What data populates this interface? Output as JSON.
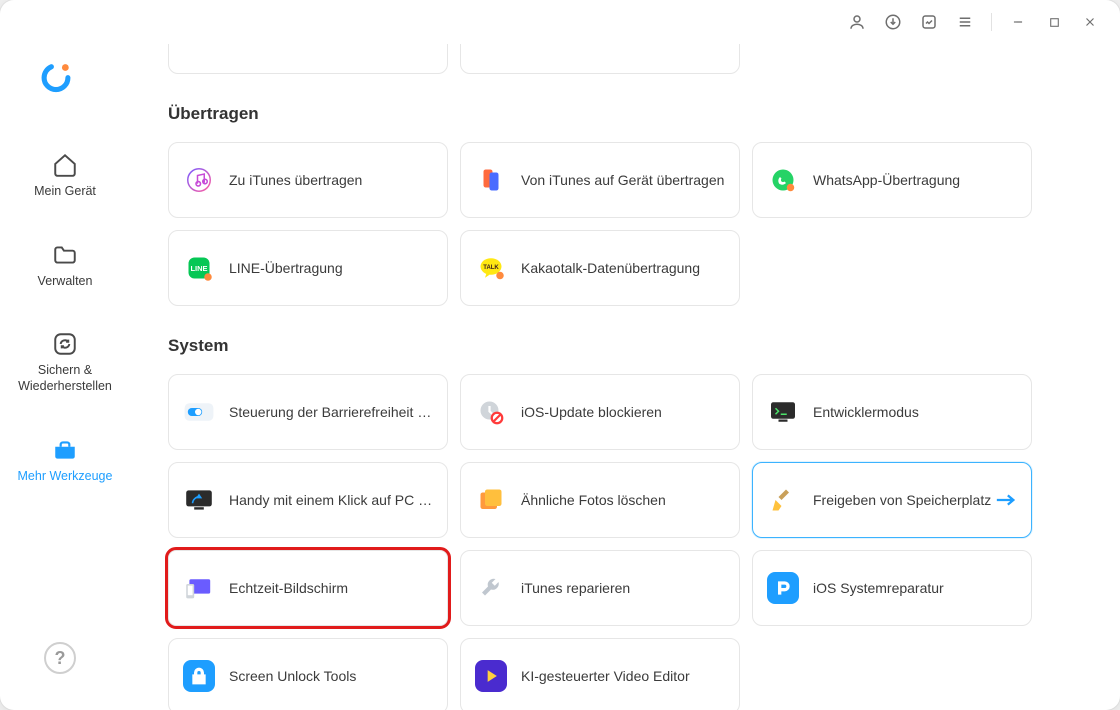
{
  "sidebar": {
    "logo_alt": "App logo",
    "items": [
      {
        "label": "Mein Gerät"
      },
      {
        "label": "Verwalten"
      },
      {
        "label": "Sichern & Wiederherstellen"
      },
      {
        "label": "Mehr Werkzeuge"
      }
    ],
    "help_label": "?"
  },
  "sections": {
    "ubertragen": {
      "title": "Übertragen",
      "cards": [
        {
          "label": "Zu iTunes übertragen"
        },
        {
          "label": "Von iTunes auf Gerät übertragen"
        },
        {
          "label": "WhatsApp-Übertragung"
        },
        {
          "label": "LINE-Übertragung"
        },
        {
          "label": "Kakaotalk-Datenübertragung"
        }
      ]
    },
    "system": {
      "title": "System",
      "cards": [
        {
          "label": "Steuerung der Barrierefreiheit von"
        },
        {
          "label": "iOS-Update blockieren"
        },
        {
          "label": "Entwicklermodus"
        },
        {
          "label": "Handy mit einem Klick auf PC spie"
        },
        {
          "label": "Ähnliche Fotos löschen"
        },
        {
          "label": "Freigeben von Speicherplatz"
        },
        {
          "label": "Echtzeit-Bildschirm"
        },
        {
          "label": "iTunes reparieren"
        },
        {
          "label": "iOS Systemreparatur"
        },
        {
          "label": "Screen Unlock Tools"
        },
        {
          "label": "KI-gesteuerter Video Editor"
        }
      ]
    }
  }
}
